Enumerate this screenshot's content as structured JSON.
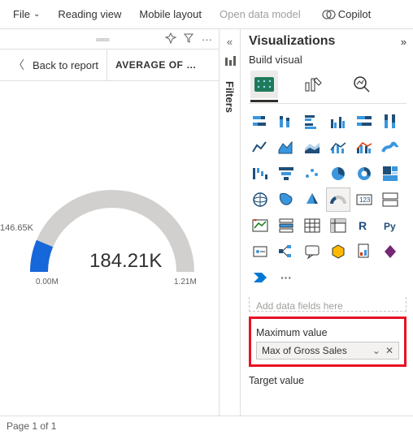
{
  "menubar": {
    "file": "File",
    "reading_view": "Reading view",
    "mobile_layout": "Mobile layout",
    "open_data_model": "Open data model",
    "copilot": "Copilot"
  },
  "report": {
    "back": "Back to report",
    "title": "AVERAGE OF …",
    "gauge": {
      "min_label": "146.65K",
      "value": "184.21K",
      "scale_lo": "0.00M",
      "scale_hi": "1.21M"
    }
  },
  "filters": {
    "label": "Filters"
  },
  "viz": {
    "title": "Visualizations",
    "build": "Build visual",
    "placeholder": "Add data fields here",
    "max_label": "Maximum value",
    "max_chip": "Max of Gross Sales",
    "target_label": "Target value",
    "more": "···"
  },
  "chart_data": {
    "type": "gauge",
    "value_label": "184.21K",
    "min_label": "146.65K",
    "scale": {
      "min_label": "0.00M",
      "max_label": "1.21M"
    },
    "value": 184210,
    "min": 0,
    "max": 1210000,
    "fill_start": 146650,
    "title": "AVERAGE OF …"
  },
  "footer": {
    "page": "Page 1 of 1"
  }
}
